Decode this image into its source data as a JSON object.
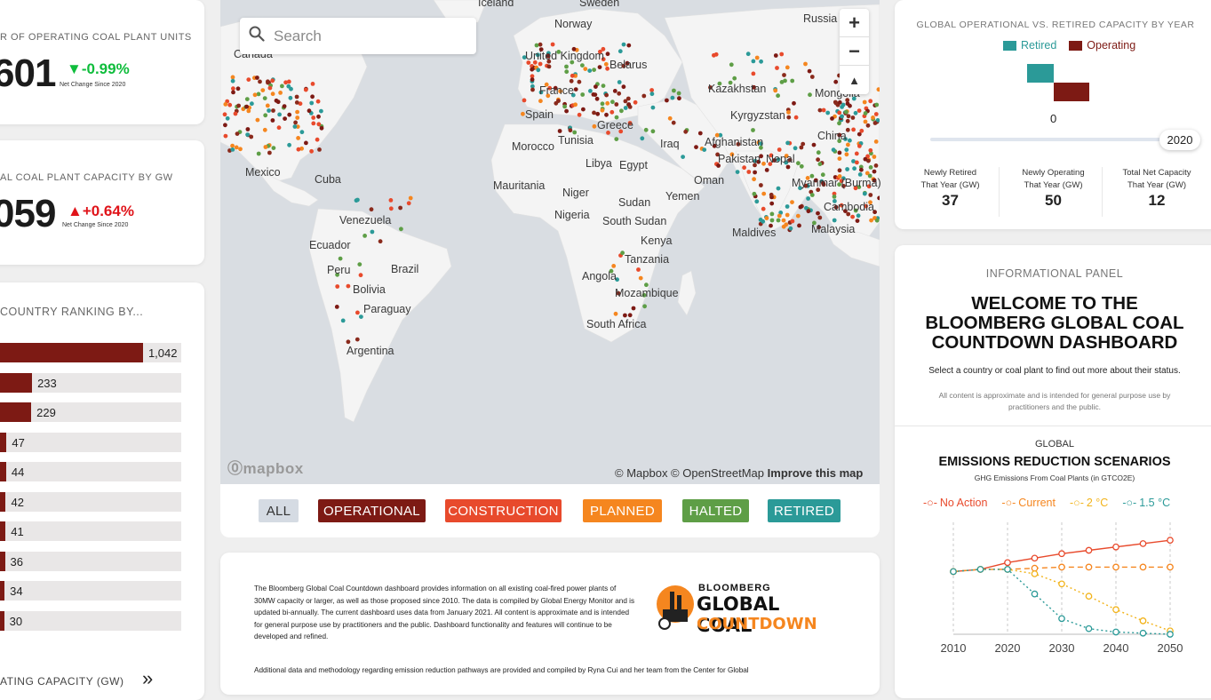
{
  "units_card": {
    "title": "R OF OPERATING COAL PLANT UNITS",
    "value": "601",
    "delta": "-0.99%",
    "delta_sub": "Net Change Since 2020",
    "delta_color": "#0fbd3c"
  },
  "capacity_card": {
    "title": "AL COAL PLANT CAPACITY BY GW",
    "value": "059",
    "delta": "+0.64%",
    "delta_sub": "Net Change Since 2020",
    "delta_color": "#e0141a"
  },
  "ranking_card": {
    "title": "COUNTRY RANKING BY...",
    "rows": [
      {
        "value": "1,042",
        "fraction": 0.87
      },
      {
        "value": "233",
        "fraction": 0.195
      },
      {
        "value": "229",
        "fraction": 0.19
      },
      {
        "value": "47",
        "fraction": 0.04
      },
      {
        "value": "44",
        "fraction": 0.037
      },
      {
        "value": "42",
        "fraction": 0.035
      },
      {
        "value": "41",
        "fraction": 0.034
      },
      {
        "value": "36",
        "fraction": 0.03
      },
      {
        "value": "34",
        "fraction": 0.028
      },
      {
        "value": "30",
        "fraction": 0.025
      }
    ]
  },
  "bottom_left": {
    "label": "ATING CAPACITY (GW)",
    "chevron": "»"
  },
  "map": {
    "search_placeholder": "Search",
    "zoom_in": "+",
    "zoom_out": "−",
    "compass": "▲",
    "countries": [
      "Iceland",
      "Sweden",
      "Norway",
      "Russia",
      "Canada",
      "United Kingdom",
      "Belarus",
      "Kazakhstan",
      "Mongolia",
      "France",
      "Spain",
      "Kyrgyzstan",
      "Greece",
      "Tunisia",
      "Iraq",
      "Afghanistan",
      "China",
      "Morocco",
      "Libya",
      "Egypt",
      "Pakistan",
      "Nepal",
      "Mexico",
      "Cuba",
      "Oman",
      "Mauritania",
      "Niger",
      "Sudan",
      "Yemen",
      "Myanmar (Burma)",
      "Nigeria",
      "South Sudan",
      "Cambodia",
      "Venezuela",
      "Kenya",
      "Ecuador",
      "Maldives",
      "Malaysia",
      "Brazil",
      "Peru",
      "Tanzania",
      "Angola",
      "Bolivia",
      "Mozambique",
      "Paraguay",
      "South Africa",
      "Argentina"
    ],
    "attribution": "© Mapbox © OpenStreetMap",
    "improve": "Improve this map",
    "logo": "mapbox"
  },
  "filters": [
    {
      "label": "ALL",
      "color": "#d5dbe3",
      "text": "#333"
    },
    {
      "label": "OPERATIONAL",
      "color": "#7d1a14",
      "text": "#fff"
    },
    {
      "label": "CONSTRUCTION",
      "color": "#e84a2c",
      "text": "#fff"
    },
    {
      "label": "PLANNED",
      "color": "#f5861f",
      "text": "#fff"
    },
    {
      "label": "HALTED",
      "color": "#5e9e46",
      "text": "#fff"
    },
    {
      "label": "RETIRED",
      "color": "#2b9a98",
      "text": "#fff"
    }
  ],
  "about": {
    "paragraph1": "The Bloomberg Global Coal Countdown dashboard provides information on all existing coal-fired power plants of 30MW capacity or larger, as well as those proposed since 2010. The data is compiled by Global Energy Monitor and is updated bi-annually. The current dashboard uses data from January 2021. All content is approximate and is intended for general purpose use by practitioners and the public. Dashboard functionality and features will continue to be developed and refined.",
    "paragraph2": "Additional data and methodology regarding emission reduction pathways are provided and compiled by Ryna Cui and her team from the Center for Global",
    "logo_line1": "BLOOMBERG",
    "logo_line2": "GLOBAL COAL",
    "logo_line3": "COUNTDOWN"
  },
  "capacity_year": {
    "title": "GLOBAL OPERATIONAL VS. RETIRED CAPACITY BY YEAR",
    "legend": [
      {
        "name": "Retired",
        "color": "#2b9a98"
      },
      {
        "name": "Operating",
        "color": "#7d1a14"
      }
    ],
    "zero": "0",
    "year": "2020",
    "stats": [
      {
        "label1": "Newly Retired",
        "label2": "That Year (GW)",
        "value": "37"
      },
      {
        "label1": "Newly Operating",
        "label2": "That Year (GW)",
        "value": "50"
      },
      {
        "label1": "Total Net Capacity",
        "label2": "That Year (GW)",
        "value": "12"
      }
    ]
  },
  "info_panel": {
    "title": "INFORMATIONAL PANEL",
    "welcome": "WELCOME TO THE BLOOMBERG GLOBAL COAL COUNTDOWN DASHBOARD",
    "instruction": "Select a country or coal plant to find out more about their status.",
    "disclaimer": "All content is approximate and is intended for general purpose use by practitioners and the public."
  },
  "emissions": {
    "kicker": "GLOBAL",
    "title": "EMISSIONS REDUCTION SCENARIOS",
    "subtitle": "GHG Emissions From Coal Plants (in GTCO2E)"
  },
  "chart_data": {
    "type": "line",
    "x": [
      2010,
      2015,
      2020,
      2025,
      2030,
      2035,
      2040,
      2045,
      2050
    ],
    "xticks": [
      "2010",
      "2020",
      "2030",
      "2040",
      "2050"
    ],
    "ylim": [
      0,
      1
    ],
    "series": [
      {
        "name": "No Action",
        "color": "#e84a2c",
        "dash": "",
        "values": [
          0.56,
          0.58,
          0.64,
          0.68,
          0.72,
          0.75,
          0.78,
          0.81,
          0.84
        ]
      },
      {
        "name": "Current",
        "color": "#f5861f",
        "dash": "6,4",
        "values": [
          0.56,
          0.58,
          0.58,
          0.59,
          0.6,
          0.6,
          0.6,
          0.6,
          0.6
        ]
      },
      {
        "name": "2 °C",
        "color": "#f2b31a",
        "dash": "2,3",
        "values": [
          0.56,
          0.58,
          0.58,
          0.54,
          0.45,
          0.34,
          0.22,
          0.12,
          0.03
        ]
      },
      {
        "name": "1.5 °C",
        "color": "#2b9a98",
        "dash": "2,3",
        "values": [
          0.56,
          0.58,
          0.58,
          0.36,
          0.14,
          0.05,
          0.02,
          0.01,
          0.0
        ]
      }
    ]
  }
}
